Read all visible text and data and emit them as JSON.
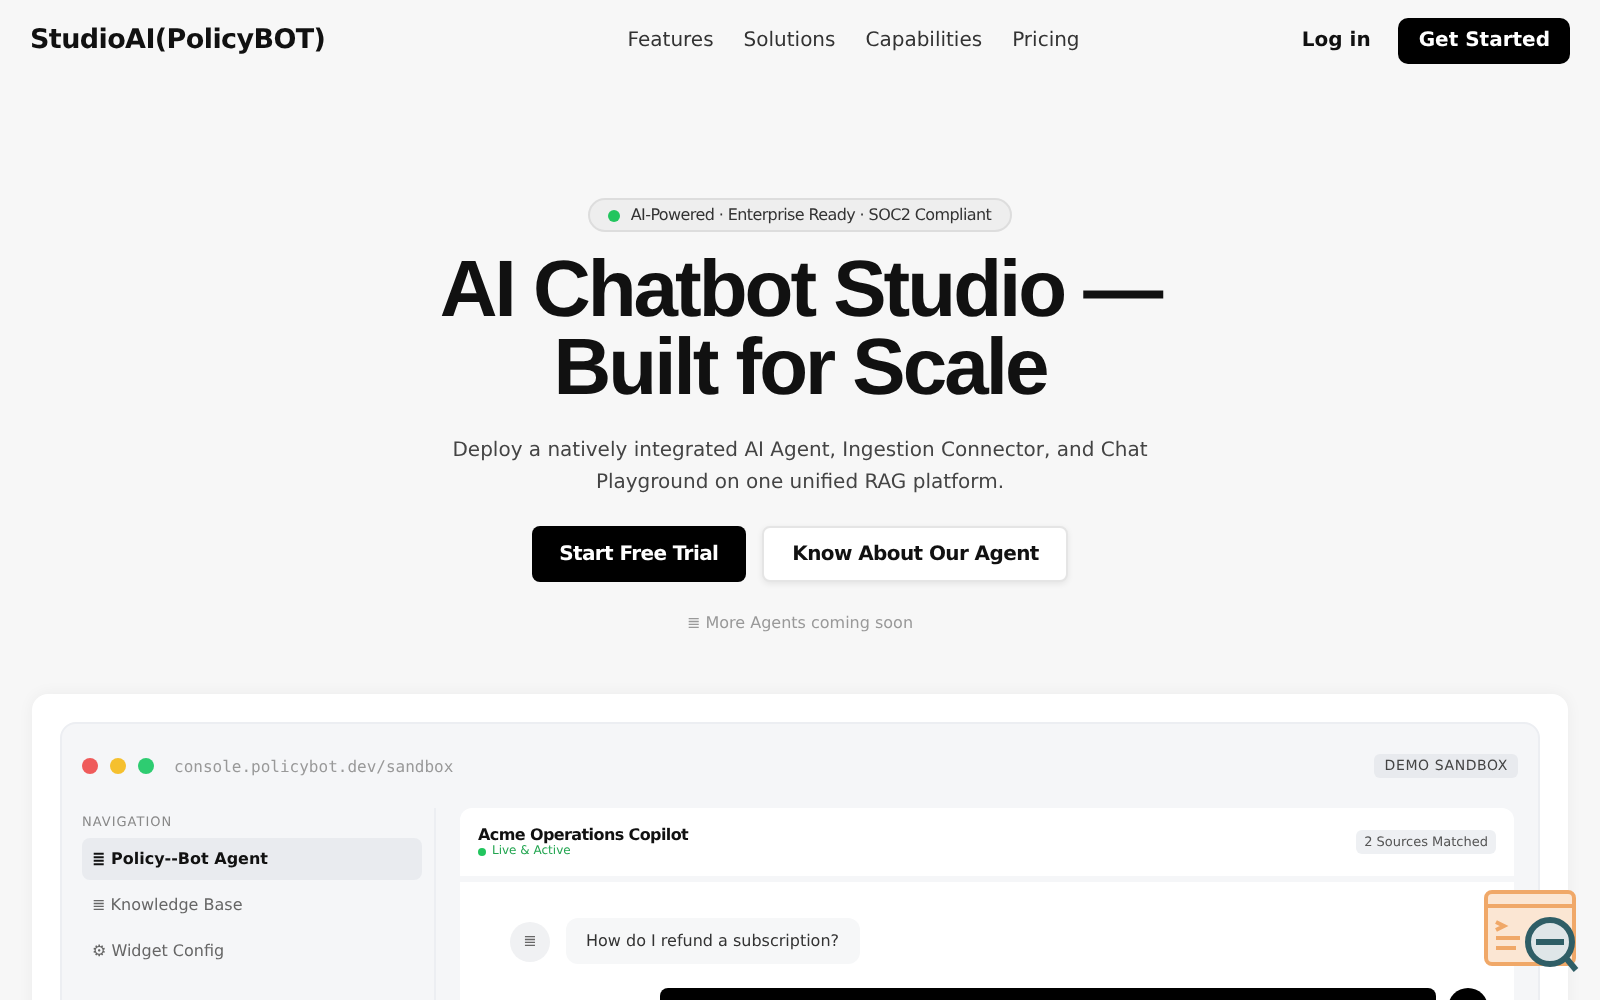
{
  "brand": "StudioAI(PolicyBOT)",
  "nav": [
    "Features",
    "Solutions",
    "Capabilities",
    "Pricing"
  ],
  "login": "Log in",
  "cta": "Get Started",
  "badge": {
    "text": "AI-Powered · Enterprise Ready · SOC2 Compliant",
    "color": "#22c55e"
  },
  "title": [
    "AI Chatbot Studio —",
    "Built for Scale"
  ],
  "subtitle": "Deploy a natively integrated AI Agent, Ingestion Connector, and Chat Playground on one unified RAG platform.",
  "buttons": [
    {
      "label": "Start Free Trial",
      "kind": "primary"
    },
    {
      "label": "Know About Our Agent",
      "kind": "secondary"
    }
  ],
  "note": "≣ More Agents coming soon",
  "demo": {
    "url": "console.policybot.dev/sandbox",
    "tag": "DEMO SANDBOX",
    "nav_heading": "NAVIGATION",
    "nav_items": [
      {
        "label": "≣ Policy--Bot Agent",
        "selected": true
      },
      {
        "label": "≣ Knowledge Base",
        "selected": false
      },
      {
        "label": "⚙ Widget Config",
        "selected": false
      }
    ],
    "chat_title": "Acme Operations Copilot",
    "status": {
      "text": "Live & Active",
      "color": "#22c55e"
    },
    "sources": "2 Sources Matched",
    "user_avatar": "≣",
    "user_message": "How do I refund a subscription?"
  }
}
